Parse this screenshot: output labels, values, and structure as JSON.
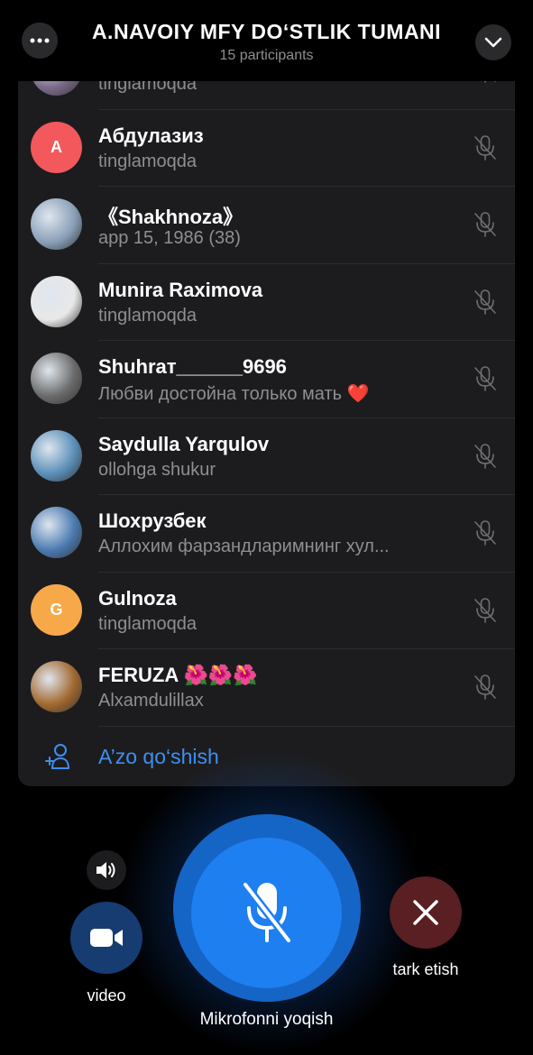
{
  "header": {
    "title": "A.NAVOIY MFY DO‘STLIK TUMANI",
    "subtitle": "15 participants"
  },
  "participants": [
    {
      "name": "",
      "status": "tinglamoqda",
      "avatar": "photo",
      "color": "#7a6a8a"
    },
    {
      "name": "Абдулазиз",
      "status": "tinglamoqda",
      "avatar": "letter",
      "letter": "A",
      "color": "#f2585c"
    },
    {
      "name": "《Shakhnoza》",
      "status": "арр 15, 1986 (38)",
      "avatar": "photo",
      "color": "#8aa0b8"
    },
    {
      "name": "Munira Raximova",
      "status": "tinglamoqda",
      "avatar": "photo",
      "color": "#e8e8e8"
    },
    {
      "name": "Shuhraт______9696",
      "status": "Любви достойна только мать ❤️",
      "avatar": "photo",
      "color": "#6a6a6a"
    },
    {
      "name": "Saydulla Yarqulov",
      "status": "ollohga shukur",
      "avatar": "photo",
      "color": "#5b8fb8"
    },
    {
      "name": "Шохрузбек",
      "status": "Аллохим фарзандларимнинг хул...",
      "avatar": "photo",
      "color": "#4a7ab0"
    },
    {
      "name": "Gulnoza",
      "status": "tinglamoqda",
      "avatar": "letter",
      "letter": "G",
      "color": "#f7a94a"
    },
    {
      "name": "FERUZA 🌺🌺🌺",
      "status": "Alxamdulillax",
      "avatar": "photo",
      "color": "#a0682e"
    }
  ],
  "add_member": {
    "label": "A’zo qo‘shish"
  },
  "controls": {
    "video_label": "video",
    "mic_label": "Mikrofonni yoqish",
    "leave_label": "tark etish"
  },
  "colors": {
    "accent": "#3e8ff2",
    "mic": "#1e7ff0",
    "leave": "#5a1f23",
    "video": "#163c72"
  }
}
